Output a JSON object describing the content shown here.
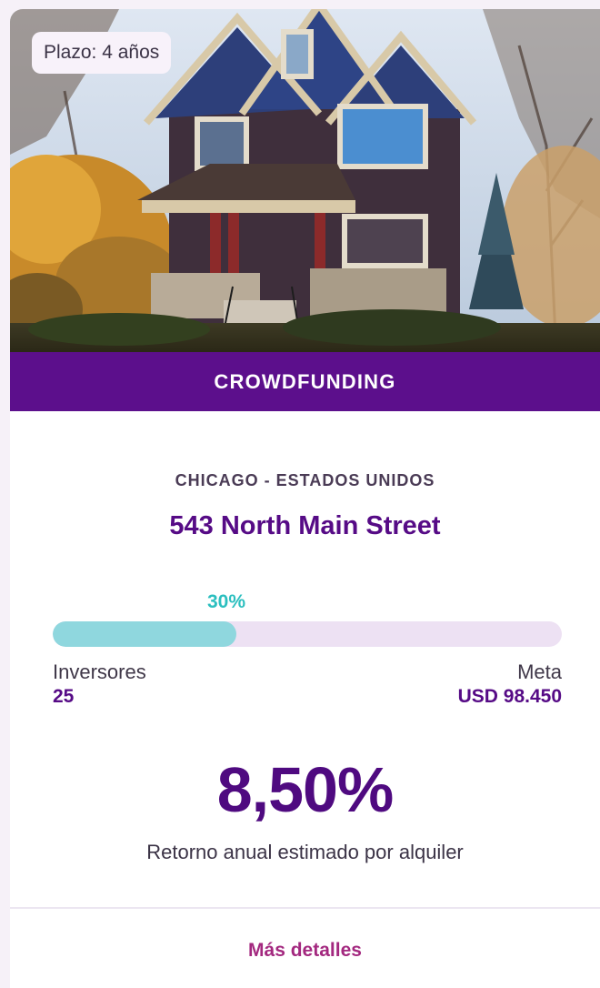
{
  "card": {
    "term_badge": "Plazo: 4 años",
    "category": "CROWDFUNDING",
    "location": "CHICAGO - ESTADOS UNIDOS",
    "address": "543 North Main Street",
    "progress": {
      "percent_label": "30%",
      "fraction": 0.36
    },
    "investors": {
      "label": "Inversores",
      "value": "25"
    },
    "goal": {
      "label": "Meta",
      "value": "USD 98.450"
    },
    "return_rate": "8,50%",
    "return_caption": "Retorno anual estimado por alquiler",
    "details_link": "Más detalles"
  },
  "colors": {
    "brand_purple": "#5c0f8c",
    "progress_fill": "#8fd7de",
    "progress_track": "#ede1f3",
    "progress_label": "#2cbfbf",
    "link": "#a3287f"
  },
  "image": {
    "subject": "house-photo"
  }
}
